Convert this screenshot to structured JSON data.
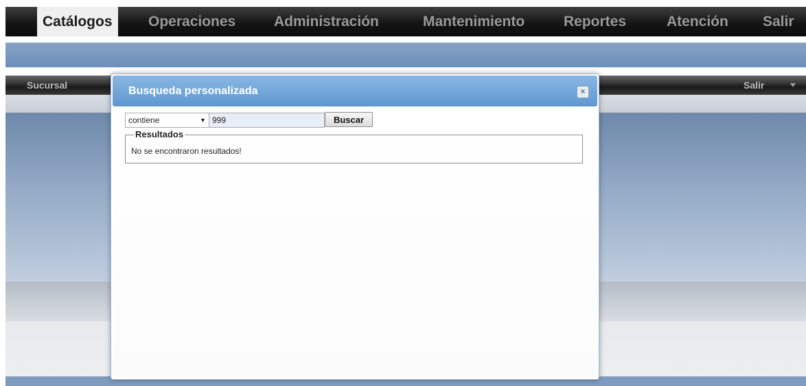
{
  "menu": {
    "items": [
      {
        "label": "Catálogos",
        "active": true
      },
      {
        "label": "Operaciones"
      },
      {
        "label": "Administración"
      },
      {
        "label": "Mantenimiento"
      },
      {
        "label": "Reportes"
      },
      {
        "label": "Atención"
      },
      {
        "label": "Salir"
      }
    ]
  },
  "subbar": {
    "left_label": "Sucursal",
    "right_label": "Salir"
  },
  "dialog": {
    "title": "Busqueda personalizada",
    "close_symbol": "×",
    "filter_select": {
      "selected": "contiene",
      "arrow": "▼"
    },
    "search_value": "999",
    "search_button": "Buscar",
    "results": {
      "legend": "Resultados",
      "message": "No se encontraron resultados!"
    }
  },
  "colors": {
    "menubar": "#151515",
    "menu_active_bg": "#efefef",
    "bluebar": "#7b98bf",
    "dialog_title_bg": "#6ea3d8"
  },
  "icons": {
    "close": "close-icon",
    "dropdown": "chevron-down-icon"
  }
}
